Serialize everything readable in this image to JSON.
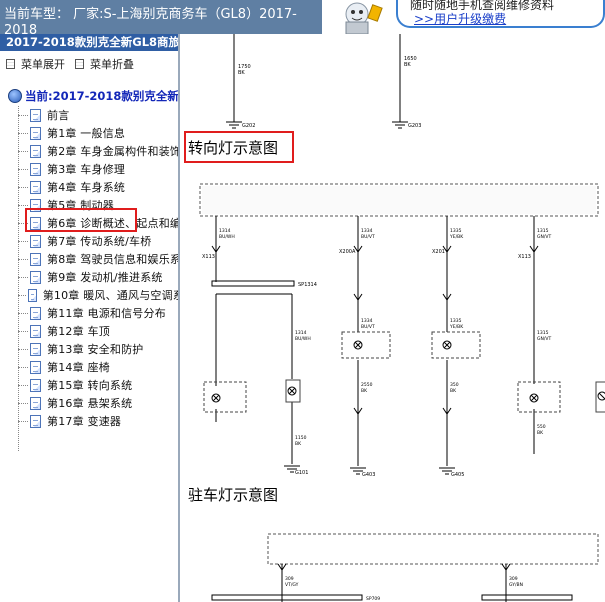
{
  "header": {
    "vehicle_label": "当前车型：",
    "vehicle_value": "厂家:S-上海别克商务车（GL8）2017-2018",
    "promo_line1": "随时随地手机查阅维修资料",
    "promo_link": ">>用户升级缴费"
  },
  "sidebar": {
    "title": "2017-2018款别克全新GL8商旅车",
    "expand_label": "菜单展开",
    "collapse_label": "菜单折叠",
    "current_label": "当前:2017-2018款别克全新",
    "items": [
      {
        "label": "前言"
      },
      {
        "label": "第1章 一般信息"
      },
      {
        "label": "第2章 车身金属构件和装饰"
      },
      {
        "label": "第3章 车身修理"
      },
      {
        "label": "第4章 车身系统"
      },
      {
        "label": "第5章 制动器"
      },
      {
        "label": "第6章 诊断概述、起点和编"
      },
      {
        "label": "第7章 传动系统/车桥"
      },
      {
        "label": "第8章 驾驶员信息和娱乐系"
      },
      {
        "label": "第9章 发动机/推进系统"
      },
      {
        "label": "第10章 暖风、通风与空调系"
      },
      {
        "label": "第11章 电源和信号分布"
      },
      {
        "label": "第12章 车顶"
      },
      {
        "label": "第13章 安全和防护"
      },
      {
        "label": "第14章 座椅"
      },
      {
        "label": "第15章 转向系统"
      },
      {
        "label": "第16章 悬架系统"
      },
      {
        "label": "第17章 变速器"
      }
    ]
  },
  "content": {
    "section1_title": "转向灯示意图",
    "section2_title": "驻车灯示意图",
    "top_labels": {
      "wire1_num": "1750",
      "wire1_color": "BK",
      "ground1": "G202",
      "wire2_num": "1650",
      "wire2_color": "BK",
      "ground2": "G203"
    },
    "turn_diagram": {
      "wires_top": [
        {
          "num": "1314",
          "color": "BU/WH"
        },
        {
          "num": "1334",
          "color": "BU/VT"
        },
        {
          "num": "1335",
          "color": "YE/BK"
        },
        {
          "num": "1315",
          "color": "GN/VT"
        }
      ],
      "connectors": [
        "X113",
        "X200A",
        "X201",
        "X113"
      ],
      "splice": "SP1314",
      "wires_mid": [
        {
          "num": "1314",
          "color": "BU/WH"
        },
        {
          "num": "1334",
          "color": "BU/VT"
        },
        {
          "num": "1335",
          "color": "YE/BK"
        },
        {
          "num": "1315",
          "color": "GN/VT"
        }
      ],
      "wires_bottom": [
        {
          "num": "1150",
          "color": "BK"
        },
        {
          "num": "2550",
          "color": "BK"
        },
        {
          "num": "350",
          "color": "BK"
        },
        {
          "num": "550",
          "color": "BK"
        }
      ],
      "grounds": [
        "G101",
        "G403",
        "G405"
      ]
    },
    "park_diagram": {
      "wires": [
        {
          "num": "309",
          "color": "VT/GY"
        },
        {
          "num": "309",
          "color": "GY/BN"
        }
      ],
      "splice": "SP709"
    }
  },
  "colors": {
    "header_bg": "#5f7fa3",
    "sidebar_title_bg": "#2f5ea4",
    "current_text": "#1327b8",
    "highlight_red": "#e01d1d",
    "link_blue": "#1a3fc9"
  }
}
